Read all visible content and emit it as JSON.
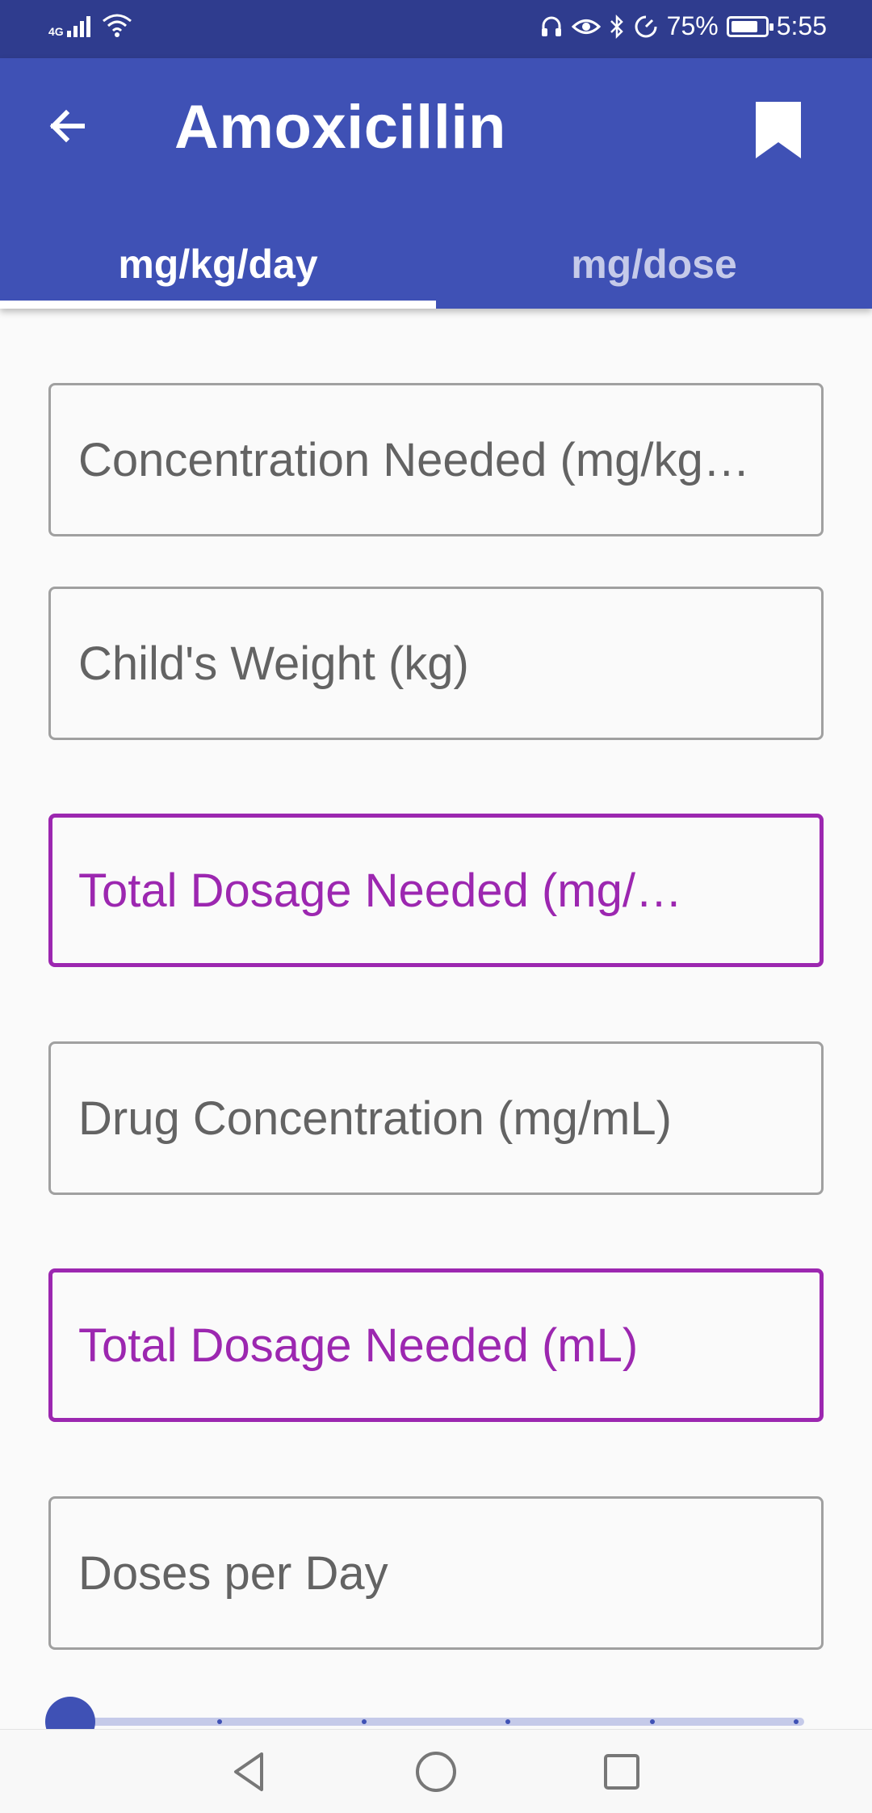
{
  "status_bar": {
    "network": "4G",
    "battery_percent": "75%",
    "time": "5:55",
    "icons": [
      "headset-icon",
      "eye-icon",
      "bluetooth-icon",
      "data-saver-icon"
    ]
  },
  "app_bar": {
    "title": "Amoxicillin",
    "back_icon": "arrow-back-icon",
    "bookmark_icon": "bookmark-icon"
  },
  "tabs": [
    {
      "label": "mg/kg/day",
      "selected": true
    },
    {
      "label": "mg/dose",
      "selected": false
    }
  ],
  "fields": [
    {
      "placeholder": "Concentration Needed (mg/kg…",
      "highlighted": false
    },
    {
      "placeholder": "Child's Weight (kg)",
      "highlighted": false
    },
    {
      "placeholder": "Total Dosage Needed (mg/…",
      "highlighted": true
    },
    {
      "placeholder": "Drug Concentration (mg/mL)",
      "highlighted": false
    },
    {
      "placeholder": "Total Dosage Needed (mL)",
      "highlighted": true
    },
    {
      "placeholder": "Doses per Day",
      "highlighted": false
    }
  ],
  "slider": {
    "value": 0,
    "steps": 5
  },
  "colors": {
    "primary": "#3f51b5",
    "primary_dark": "#2f3c8e",
    "accent": "#9c27b0",
    "tab_inactive": "#c5cae9"
  },
  "nav_bar": [
    "back-triangle-icon",
    "home-circle-icon",
    "recents-square-icon"
  ]
}
